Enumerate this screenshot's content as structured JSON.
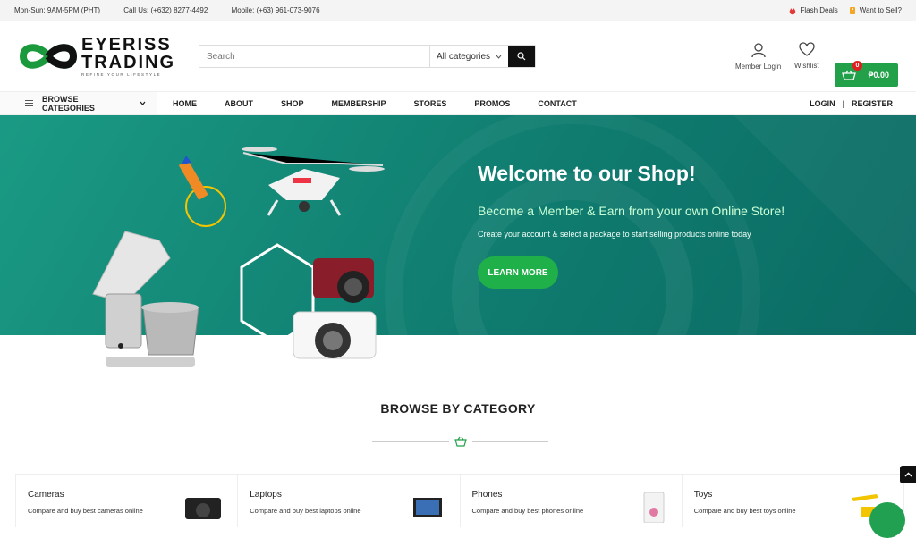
{
  "topbar": {
    "hours": "Mon-Sun: 9AM-5PM (PHT)",
    "call": "Call Us: (+632) 8277-4492",
    "mobile": "Mobile: (+63) 961-073-9076",
    "flash_deals": "Flash Deals",
    "want_to_sell": "Want to Sell?"
  },
  "logo": {
    "line1": "EYERISS",
    "line2": "TRADING",
    "tagline": "REFINE YOUR LIFESTYLE"
  },
  "search": {
    "placeholder": "Search",
    "category": "All categories"
  },
  "header": {
    "member_login": "Member Login",
    "wishlist": "Wishlist",
    "cart_count": "0",
    "cart_total": "₱0.00"
  },
  "nav": {
    "browse": "BROWSE CATEGORIES",
    "links": [
      "HOME",
      "ABOUT",
      "SHOP",
      "MEMBERSHIP",
      "STORES",
      "PROMOS",
      "CONTACT"
    ],
    "login": "LOGIN",
    "sep": "|",
    "register": "REGISTER"
  },
  "hero": {
    "title": "Welcome to our Shop!",
    "subtitle": "Become a Member & Earn from your own Online Store!",
    "text": "Create your account & select a package to start selling products online today",
    "button": "LEARN MORE"
  },
  "section": {
    "title": "BROWSE BY CATEGORY"
  },
  "categories": [
    {
      "name": "Cameras",
      "desc": "Compare and buy best cameras online"
    },
    {
      "name": "Laptops",
      "desc": "Compare and buy best laptops online"
    },
    {
      "name": "Phones",
      "desc": "Compare and buy best phones online"
    },
    {
      "name": "Toys",
      "desc": "Compare and buy best toys online"
    }
  ],
  "colors": {
    "brand_green": "#22a04a",
    "hero_teal": "#0f7a6e",
    "accent_light": "#c8ffd6"
  },
  "icons": [
    "fire-icon",
    "tag-icon",
    "search-icon",
    "chevron-down-icon",
    "user-icon",
    "heart-icon",
    "basket-icon",
    "menu-icon",
    "chevron-up-icon"
  ]
}
